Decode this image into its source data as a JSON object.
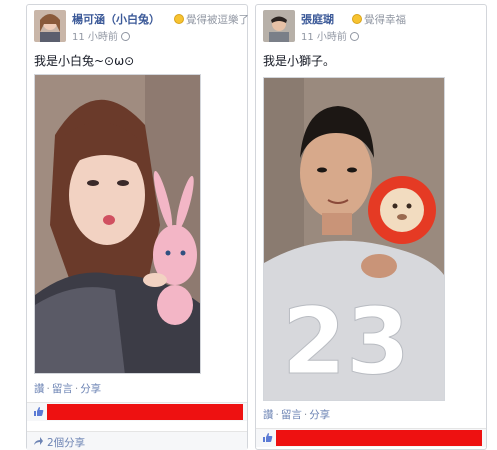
{
  "posts": [
    {
      "author": "楊可涵（小白兔）",
      "feeling": "覺得被逗樂了",
      "time": "11 小時前",
      "text": "我是小白兔~⊙ω⊙",
      "actions": [
        "讚",
        "留言",
        "分享"
      ],
      "shares": "2個分享"
    },
    {
      "author": "張庭瑚",
      "feeling": "覺得幸福",
      "time": "11 小時前",
      "text": "我是小獅子。",
      "actions": [
        "讚",
        "留言",
        "分享"
      ]
    }
  ],
  "colors": {
    "link": "#3b5998",
    "meta": "#9197a3",
    "redaction": "#ee1111",
    "border": "#d3d6db"
  },
  "icons": [
    "smile-icon",
    "globe-icon",
    "thumbs-up-icon",
    "share-arrow-icon"
  ]
}
